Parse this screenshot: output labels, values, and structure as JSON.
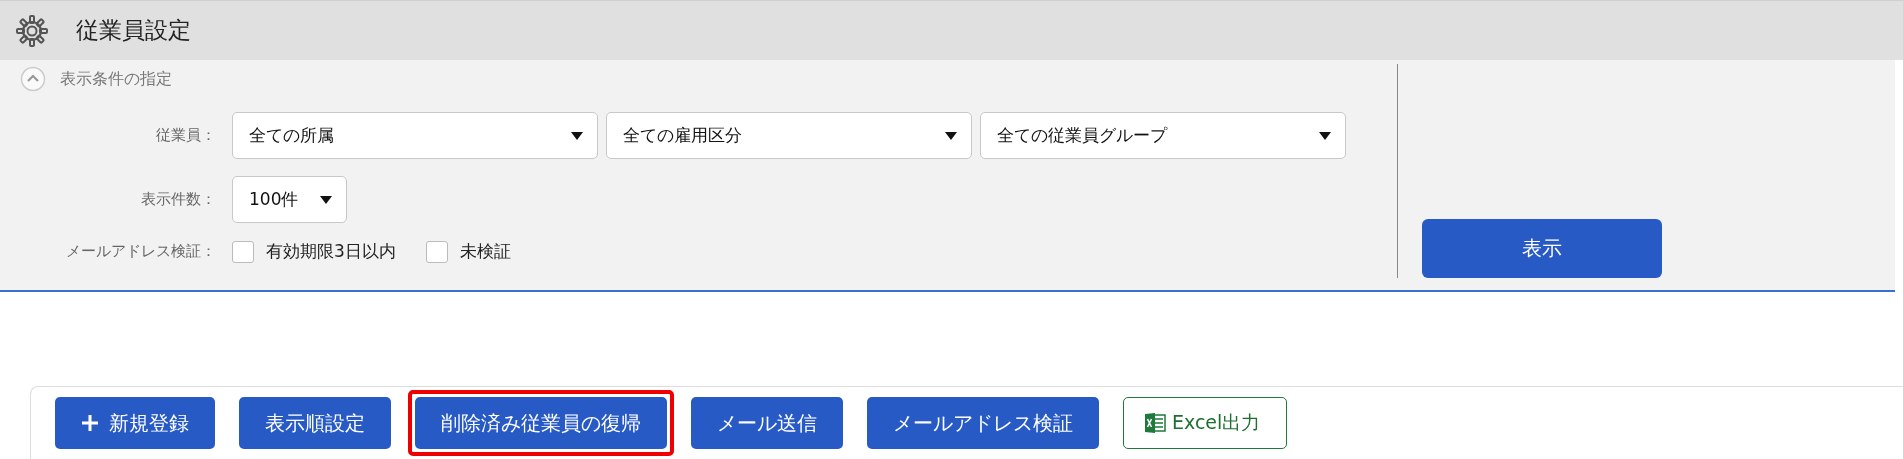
{
  "header": {
    "title": "従業員設定"
  },
  "filter": {
    "title": "表示条件の指定",
    "expanded": true,
    "rows": [
      {
        "kind": "selects",
        "label": "従業員：",
        "selects": [
          "全ての所属",
          "全ての雇用区分",
          "全ての従業員グループ"
        ]
      },
      {
        "kind": "selects",
        "label": "表示件数：",
        "selects": [
          "100件"
        ]
      },
      {
        "kind": "checkboxes",
        "label": "メールアドレス検証：",
        "options": [
          {
            "label": "有効期限3日以内",
            "checked": false
          },
          {
            "label": "未検証",
            "checked": false
          }
        ]
      }
    ],
    "submit": "表示"
  },
  "toolbar": [
    {
      "kind": "add",
      "label": "新規登録",
      "highlighted": false
    },
    {
      "kind": "primary",
      "label": "表示順設定",
      "highlighted": false
    },
    {
      "kind": "primary",
      "label": "削除済み従業員の復帰",
      "highlighted": true
    },
    {
      "kind": "primary",
      "label": "メール送信",
      "highlighted": false
    },
    {
      "kind": "primary",
      "label": "メールアドレス検証",
      "highlighted": false
    },
    {
      "kind": "excel",
      "label": "Excel出力",
      "highlighted": false
    }
  ]
}
